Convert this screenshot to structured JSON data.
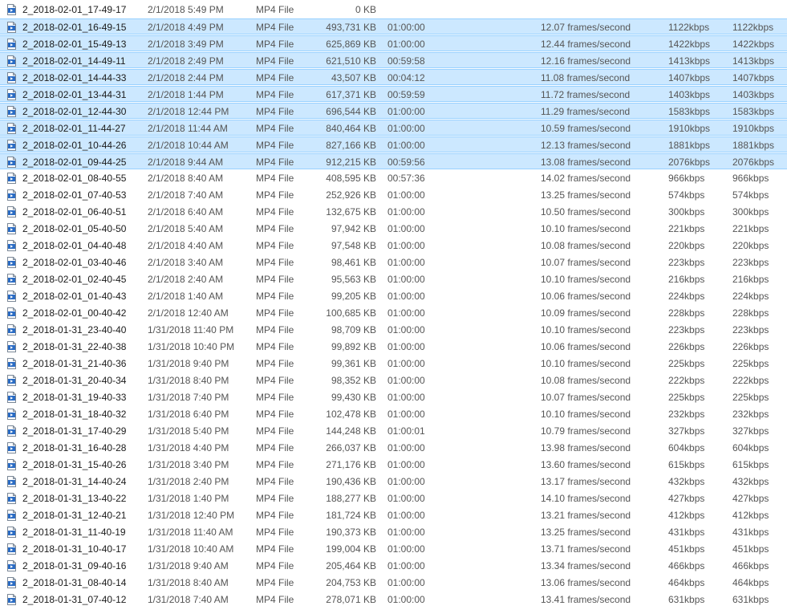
{
  "colors": {
    "selection_bg": "#cce8ff",
    "selection_border": "#99d1ff",
    "icon_blue": "#2b6cc4"
  },
  "rows": [
    {
      "name": "2_2018-02-01_17-49-17",
      "date": "2/1/2018 5:49 PM",
      "type": "MP4 File",
      "size": "0 KB",
      "length": "",
      "frame_rate": "",
      "data_rate": "",
      "total_bitrate": "",
      "selected": false
    },
    {
      "name": "2_2018-02-01_16-49-15",
      "date": "2/1/2018 4:49 PM",
      "type": "MP4 File",
      "size": "493,731 KB",
      "length": "01:00:00",
      "frame_rate": "12.07 frames/second",
      "data_rate": "1122kbps",
      "total_bitrate": "1122kbps",
      "selected": true
    },
    {
      "name": "2_2018-02-01_15-49-13",
      "date": "2/1/2018 3:49 PM",
      "type": "MP4 File",
      "size": "625,869 KB",
      "length": "01:00:00",
      "frame_rate": "12.44 frames/second",
      "data_rate": "1422kbps",
      "total_bitrate": "1422kbps",
      "selected": true
    },
    {
      "name": "2_2018-02-01_14-49-11",
      "date": "2/1/2018 2:49 PM",
      "type": "MP4 File",
      "size": "621,510 KB",
      "length": "00:59:58",
      "frame_rate": "12.16 frames/second",
      "data_rate": "1413kbps",
      "total_bitrate": "1413kbps",
      "selected": true
    },
    {
      "name": "2_2018-02-01_14-44-33",
      "date": "2/1/2018 2:44 PM",
      "type": "MP4 File",
      "size": "43,507 KB",
      "length": "00:04:12",
      "frame_rate": "11.08 frames/second",
      "data_rate": "1407kbps",
      "total_bitrate": "1407kbps",
      "selected": true
    },
    {
      "name": "2_2018-02-01_13-44-31",
      "date": "2/1/2018 1:44 PM",
      "type": "MP4 File",
      "size": "617,371 KB",
      "length": "00:59:59",
      "frame_rate": "11.72 frames/second",
      "data_rate": "1403kbps",
      "total_bitrate": "1403kbps",
      "selected": true
    },
    {
      "name": "2_2018-02-01_12-44-30",
      "date": "2/1/2018 12:44 PM",
      "type": "MP4 File",
      "size": "696,544 KB",
      "length": "01:00:00",
      "frame_rate": "11.29 frames/second",
      "data_rate": "1583kbps",
      "total_bitrate": "1583kbps",
      "selected": true
    },
    {
      "name": "2_2018-02-01_11-44-27",
      "date": "2/1/2018 11:44 AM",
      "type": "MP4 File",
      "size": "840,464 KB",
      "length": "01:00:00",
      "frame_rate": "10.59 frames/second",
      "data_rate": "1910kbps",
      "total_bitrate": "1910kbps",
      "selected": true
    },
    {
      "name": "2_2018-02-01_10-44-26",
      "date": "2/1/2018 10:44 AM",
      "type": "MP4 File",
      "size": "827,166 KB",
      "length": "01:00:00",
      "frame_rate": "12.13 frames/second",
      "data_rate": "1881kbps",
      "total_bitrate": "1881kbps",
      "selected": true
    },
    {
      "name": "2_2018-02-01_09-44-25",
      "date": "2/1/2018 9:44 AM",
      "type": "MP4 File",
      "size": "912,215 KB",
      "length": "00:59:56",
      "frame_rate": "13.08 frames/second",
      "data_rate": "2076kbps",
      "total_bitrate": "2076kbps",
      "selected": true
    },
    {
      "name": "2_2018-02-01_08-40-55",
      "date": "2/1/2018 8:40 AM",
      "type": "MP4 File",
      "size": "408,595 KB",
      "length": "00:57:36",
      "frame_rate": "14.02 frames/second",
      "data_rate": "966kbps",
      "total_bitrate": "966kbps",
      "selected": false
    },
    {
      "name": "2_2018-02-01_07-40-53",
      "date": "2/1/2018 7:40 AM",
      "type": "MP4 File",
      "size": "252,926 KB",
      "length": "01:00:00",
      "frame_rate": "13.25 frames/second",
      "data_rate": "574kbps",
      "total_bitrate": "574kbps",
      "selected": false
    },
    {
      "name": "2_2018-02-01_06-40-51",
      "date": "2/1/2018 6:40 AM",
      "type": "MP4 File",
      "size": "132,675 KB",
      "length": "01:00:00",
      "frame_rate": "10.50 frames/second",
      "data_rate": "300kbps",
      "total_bitrate": "300kbps",
      "selected": false
    },
    {
      "name": "2_2018-02-01_05-40-50",
      "date": "2/1/2018 5:40 AM",
      "type": "MP4 File",
      "size": "97,942 KB",
      "length": "01:00:00",
      "frame_rate": "10.10 frames/second",
      "data_rate": "221kbps",
      "total_bitrate": "221kbps",
      "selected": false
    },
    {
      "name": "2_2018-02-01_04-40-48",
      "date": "2/1/2018 4:40 AM",
      "type": "MP4 File",
      "size": "97,548 KB",
      "length": "01:00:00",
      "frame_rate": "10.08 frames/second",
      "data_rate": "220kbps",
      "total_bitrate": "220kbps",
      "selected": false
    },
    {
      "name": "2_2018-02-01_03-40-46",
      "date": "2/1/2018 3:40 AM",
      "type": "MP4 File",
      "size": "98,461 KB",
      "length": "01:00:00",
      "frame_rate": "10.07 frames/second",
      "data_rate": "223kbps",
      "total_bitrate": "223kbps",
      "selected": false
    },
    {
      "name": "2_2018-02-01_02-40-45",
      "date": "2/1/2018 2:40 AM",
      "type": "MP4 File",
      "size": "95,563 KB",
      "length": "01:00:00",
      "frame_rate": "10.10 frames/second",
      "data_rate": "216kbps",
      "total_bitrate": "216kbps",
      "selected": false
    },
    {
      "name": "2_2018-02-01_01-40-43",
      "date": "2/1/2018 1:40 AM",
      "type": "MP4 File",
      "size": "99,205 KB",
      "length": "01:00:00",
      "frame_rate": "10.06 frames/second",
      "data_rate": "224kbps",
      "total_bitrate": "224kbps",
      "selected": false
    },
    {
      "name": "2_2018-02-01_00-40-42",
      "date": "2/1/2018 12:40 AM",
      "type": "MP4 File",
      "size": "100,685 KB",
      "length": "01:00:00",
      "frame_rate": "10.09 frames/second",
      "data_rate": "228kbps",
      "total_bitrate": "228kbps",
      "selected": false
    },
    {
      "name": "2_2018-01-31_23-40-40",
      "date": "1/31/2018 11:40 PM",
      "type": "MP4 File",
      "size": "98,709 KB",
      "length": "01:00:00",
      "frame_rate": "10.10 frames/second",
      "data_rate": "223kbps",
      "total_bitrate": "223kbps",
      "selected": false
    },
    {
      "name": "2_2018-01-31_22-40-38",
      "date": "1/31/2018 10:40 PM",
      "type": "MP4 File",
      "size": "99,892 KB",
      "length": "01:00:00",
      "frame_rate": "10.06 frames/second",
      "data_rate": "226kbps",
      "total_bitrate": "226kbps",
      "selected": false
    },
    {
      "name": "2_2018-01-31_21-40-36",
      "date": "1/31/2018 9:40 PM",
      "type": "MP4 File",
      "size": "99,361 KB",
      "length": "01:00:00",
      "frame_rate": "10.10 frames/second",
      "data_rate": "225kbps",
      "total_bitrate": "225kbps",
      "selected": false
    },
    {
      "name": "2_2018-01-31_20-40-34",
      "date": "1/31/2018 8:40 PM",
      "type": "MP4 File",
      "size": "98,352 KB",
      "length": "01:00:00",
      "frame_rate": "10.08 frames/second",
      "data_rate": "222kbps",
      "total_bitrate": "222kbps",
      "selected": false
    },
    {
      "name": "2_2018-01-31_19-40-33",
      "date": "1/31/2018 7:40 PM",
      "type": "MP4 File",
      "size": "99,430 KB",
      "length": "01:00:00",
      "frame_rate": "10.07 frames/second",
      "data_rate": "225kbps",
      "total_bitrate": "225kbps",
      "selected": false
    },
    {
      "name": "2_2018-01-31_18-40-32",
      "date": "1/31/2018 6:40 PM",
      "type": "MP4 File",
      "size": "102,478 KB",
      "length": "01:00:00",
      "frame_rate": "10.10 frames/second",
      "data_rate": "232kbps",
      "total_bitrate": "232kbps",
      "selected": false
    },
    {
      "name": "2_2018-01-31_17-40-29",
      "date": "1/31/2018 5:40 PM",
      "type": "MP4 File",
      "size": "144,248 KB",
      "length": "01:00:01",
      "frame_rate": "10.79 frames/second",
      "data_rate": "327kbps",
      "total_bitrate": "327kbps",
      "selected": false
    },
    {
      "name": "2_2018-01-31_16-40-28",
      "date": "1/31/2018 4:40 PM",
      "type": "MP4 File",
      "size": "266,037 KB",
      "length": "01:00:00",
      "frame_rate": "13.98 frames/second",
      "data_rate": "604kbps",
      "total_bitrate": "604kbps",
      "selected": false
    },
    {
      "name": "2_2018-01-31_15-40-26",
      "date": "1/31/2018 3:40 PM",
      "type": "MP4 File",
      "size": "271,176 KB",
      "length": "01:00:00",
      "frame_rate": "13.60 frames/second",
      "data_rate": "615kbps",
      "total_bitrate": "615kbps",
      "selected": false
    },
    {
      "name": "2_2018-01-31_14-40-24",
      "date": "1/31/2018 2:40 PM",
      "type": "MP4 File",
      "size": "190,436 KB",
      "length": "01:00:00",
      "frame_rate": "13.17 frames/second",
      "data_rate": "432kbps",
      "total_bitrate": "432kbps",
      "selected": false
    },
    {
      "name": "2_2018-01-31_13-40-22",
      "date": "1/31/2018 1:40 PM",
      "type": "MP4 File",
      "size": "188,277 KB",
      "length": "01:00:00",
      "frame_rate": "14.10 frames/second",
      "data_rate": "427kbps",
      "total_bitrate": "427kbps",
      "selected": false
    },
    {
      "name": "2_2018-01-31_12-40-21",
      "date": "1/31/2018 12:40 PM",
      "type": "MP4 File",
      "size": "181,724 KB",
      "length": "01:00:00",
      "frame_rate": "13.21 frames/second",
      "data_rate": "412kbps",
      "total_bitrate": "412kbps",
      "selected": false
    },
    {
      "name": "2_2018-01-31_11-40-19",
      "date": "1/31/2018 11:40 AM",
      "type": "MP4 File",
      "size": "190,373 KB",
      "length": "01:00:00",
      "frame_rate": "13.25 frames/second",
      "data_rate": "431kbps",
      "total_bitrate": "431kbps",
      "selected": false
    },
    {
      "name": "2_2018-01-31_10-40-17",
      "date": "1/31/2018 10:40 AM",
      "type": "MP4 File",
      "size": "199,004 KB",
      "length": "01:00:00",
      "frame_rate": "13.71 frames/second",
      "data_rate": "451kbps",
      "total_bitrate": "451kbps",
      "selected": false
    },
    {
      "name": "2_2018-01-31_09-40-16",
      "date": "1/31/2018 9:40 AM",
      "type": "MP4 File",
      "size": "205,464 KB",
      "length": "01:00:00",
      "frame_rate": "13.34 frames/second",
      "data_rate": "466kbps",
      "total_bitrate": "466kbps",
      "selected": false
    },
    {
      "name": "2_2018-01-31_08-40-14",
      "date": "1/31/2018 8:40 AM",
      "type": "MP4 File",
      "size": "204,753 KB",
      "length": "01:00:00",
      "frame_rate": "13.06 frames/second",
      "data_rate": "464kbps",
      "total_bitrate": "464kbps",
      "selected": false
    },
    {
      "name": "2_2018-01-31_07-40-12",
      "date": "1/31/2018 7:40 AM",
      "type": "MP4 File",
      "size": "278,071 KB",
      "length": "01:00:00",
      "frame_rate": "13.41 frames/second",
      "data_rate": "631kbps",
      "total_bitrate": "631kbps",
      "selected": false
    }
  ]
}
